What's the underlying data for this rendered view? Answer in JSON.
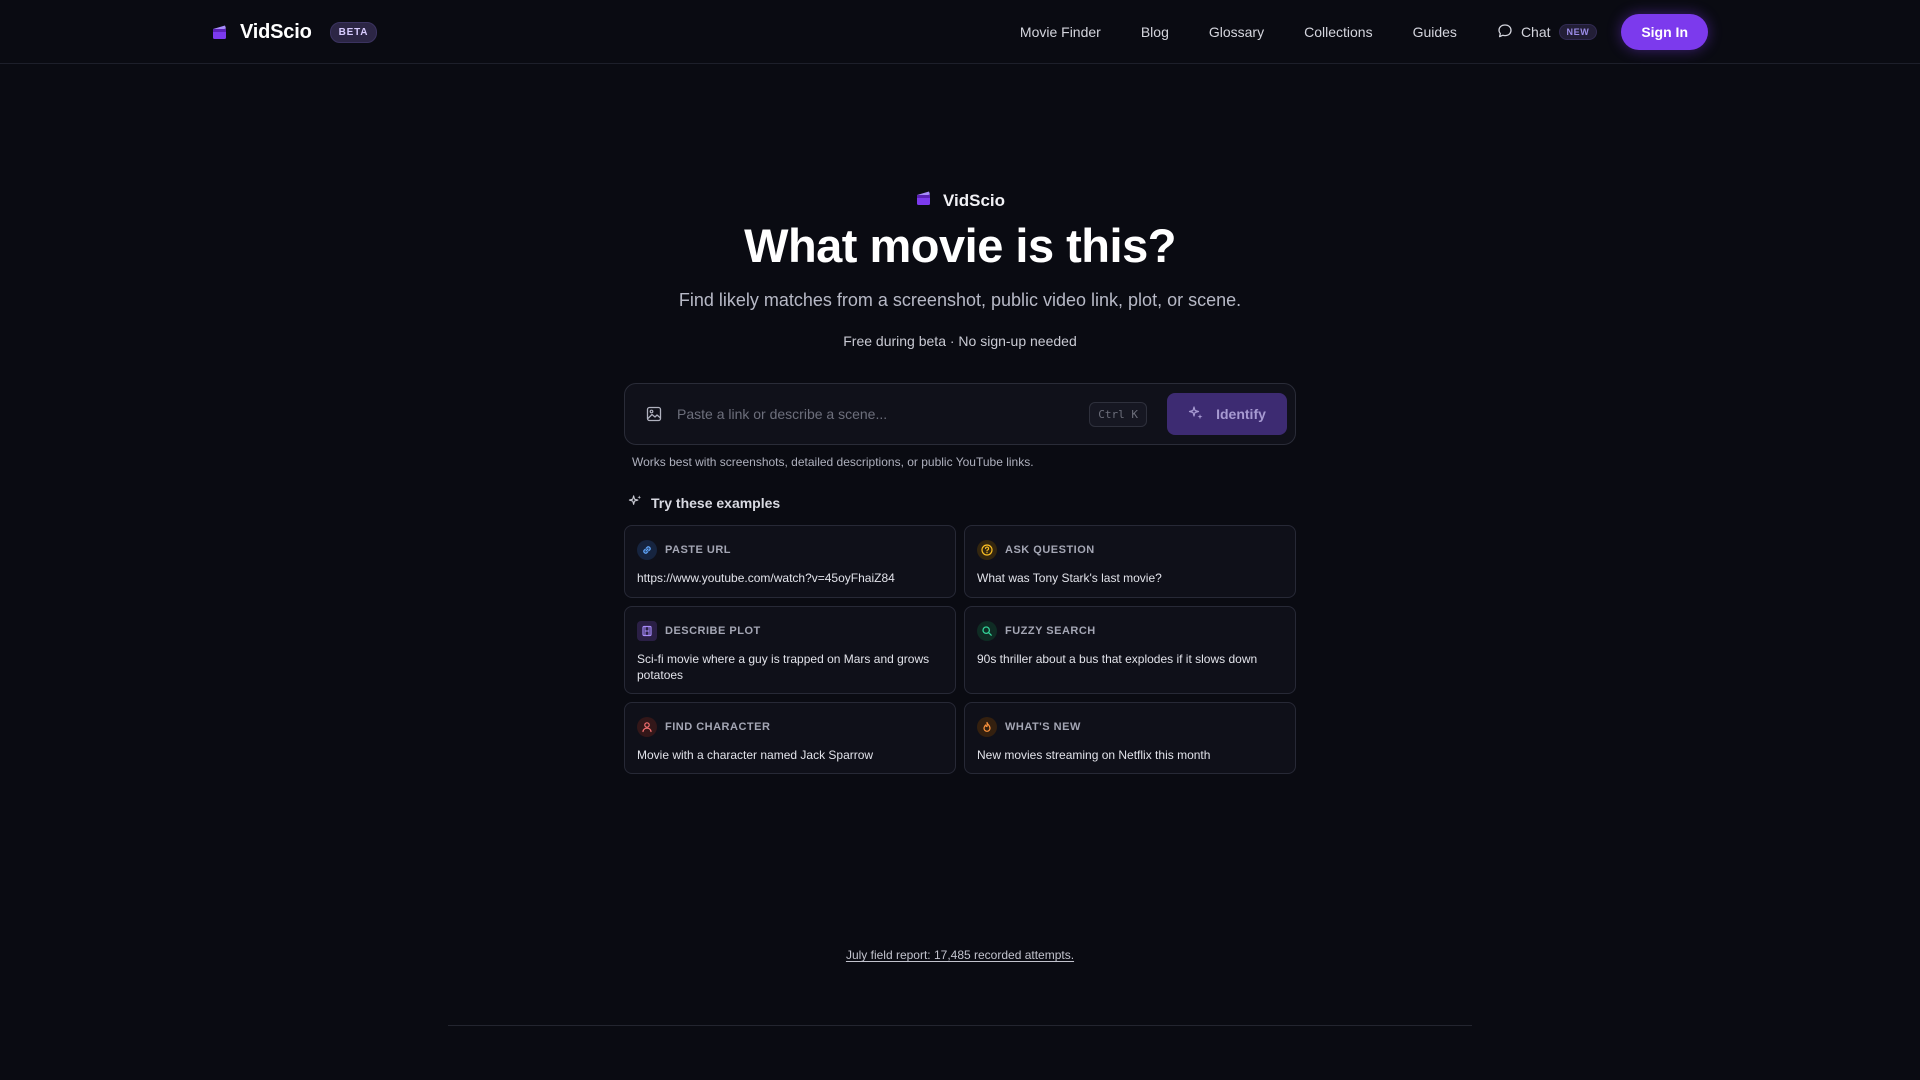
{
  "nav": {
    "brand": "VidScio",
    "badge": "BETA",
    "links": [
      "Movie Finder",
      "Blog",
      "Glossary",
      "Collections",
      "Guides"
    ],
    "chat_label": "Chat",
    "chat_badge": "NEW",
    "signin_label": "Sign In"
  },
  "hero": {
    "brand": "VidScio",
    "title": "What movie is this?",
    "subtitle": "Find likely matches from a screenshot, public video link, plot, or scene.",
    "note": "Free during beta · No sign-up needed"
  },
  "search": {
    "placeholder": "Paste a link or describe a scene...",
    "shortcut": "Ctrl K",
    "button_label": "Identify",
    "hint": "Works best with screenshots, detailed descriptions, or public YouTube links."
  },
  "examples": {
    "heading": "Try these examples",
    "items": [
      {
        "label": "PASTE URL",
        "text": "https://www.youtube.com/watch?v=45oyFhaiZ84",
        "icon": "link-icon",
        "color": "#3b82f6"
      },
      {
        "label": "ASK QUESTION",
        "text": "What was Tony Stark's last movie?",
        "icon": "question-icon",
        "color": "#f59e0b"
      },
      {
        "label": "DESCRIBE PLOT",
        "text": "Sci-fi movie where a guy is trapped on Mars and grows potatoes",
        "icon": "film-icon",
        "color": "#8b5cf6"
      },
      {
        "label": "FUZZY SEARCH",
        "text": "90s thriller about a bus that explodes if it slows down",
        "icon": "search-icon",
        "color": "#10b981"
      },
      {
        "label": "FIND CHARACTER",
        "text": "Movie with a character named Jack Sparrow",
        "icon": "person-icon",
        "color": "#ef4444"
      },
      {
        "label": "WHAT'S NEW",
        "text": "New movies streaming on Netflix this month",
        "icon": "flame-icon",
        "color": "#f97316"
      }
    ]
  },
  "footer": {
    "field_report": "July field report: 17,485 recorded attempts."
  },
  "colors": {
    "accent": "#7c3aed",
    "background": "#0a0b12"
  }
}
